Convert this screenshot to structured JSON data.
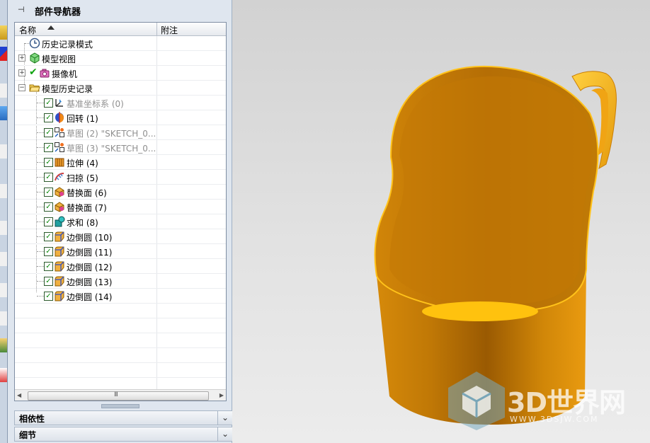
{
  "panel": {
    "title": "部件导航器",
    "columns": {
      "name": "名称",
      "note": "附注"
    },
    "rows": [
      {
        "label": "历史记录模式",
        "icon": "clock-icon",
        "indent": 0,
        "kind": "mode",
        "dim": false
      },
      {
        "label": "模型视图",
        "icon": "model-views-icon",
        "indent": 0,
        "kind": "group",
        "dim": false
      },
      {
        "label": "摄像机",
        "icon": "camera-icon",
        "indent": 0,
        "kind": "group-checked",
        "dim": false
      },
      {
        "label": "模型历史记录",
        "icon": "open-folder-icon",
        "indent": 0,
        "kind": "group-open",
        "dim": false
      },
      {
        "label": "基准坐标系 (0)",
        "icon": "datum-csys-icon",
        "indent": 1,
        "dim": true
      },
      {
        "label": "回转 (1)",
        "icon": "revolve-icon",
        "indent": 1,
        "dim": false
      },
      {
        "label": "草图 (2) \"SKETCH_0...",
        "icon": "sketch-icon",
        "indent": 1,
        "dim": true
      },
      {
        "label": "草图 (3) \"SKETCH_0...",
        "icon": "sketch-icon",
        "indent": 1,
        "dim": true
      },
      {
        "label": "拉伸 (4)",
        "icon": "extrude-icon",
        "indent": 1,
        "dim": false
      },
      {
        "label": "扫掠 (5)",
        "icon": "swept-icon",
        "indent": 1,
        "dim": false
      },
      {
        "label": "替换面 (6)",
        "icon": "replace-face-icon",
        "indent": 1,
        "dim": false
      },
      {
        "label": "替换面 (7)",
        "icon": "replace-face-icon",
        "indent": 1,
        "dim": false
      },
      {
        "label": "求和 (8)",
        "icon": "unite-icon",
        "indent": 1,
        "dim": false
      },
      {
        "label": "边倒圆 (10)",
        "icon": "edge-blend-icon",
        "indent": 1,
        "dim": false
      },
      {
        "label": "边倒圆 (11)",
        "icon": "edge-blend-icon",
        "indent": 1,
        "dim": false
      },
      {
        "label": "边倒圆 (12)",
        "icon": "edge-blend-icon",
        "indent": 1,
        "dim": false
      },
      {
        "label": "边倒圆 (13)",
        "icon": "edge-blend-icon",
        "indent": 1,
        "dim": false
      },
      {
        "label": "边倒圆 (14)",
        "icon": "edge-blend-icon",
        "indent": 1,
        "dim": false
      }
    ],
    "scroll_grip": "III",
    "sections": [
      {
        "label": "相依性"
      },
      {
        "label": "细节"
      }
    ]
  },
  "watermark": {
    "text": "3D世界网",
    "url": "WWW.3DSJW.COM"
  },
  "colors": {
    "model_orange": "#e69a10",
    "model_dark": "#b06a04",
    "model_light": "#ffc21a",
    "viewport_bg": "#dcdcdc",
    "panel_bg": "#dfe6ef"
  }
}
